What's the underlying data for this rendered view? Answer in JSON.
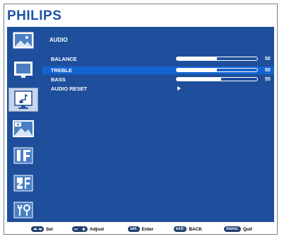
{
  "brand": "PHILIPS",
  "menu": {
    "title": "AUDIO",
    "items": [
      {
        "label": "BALANCE",
        "value": "50",
        "level": 0.5,
        "selected": false
      },
      {
        "label": "TREBLE",
        "value": "50",
        "level": 0.5,
        "selected": true
      },
      {
        "label": "BASS",
        "value": "55",
        "level": 0.55,
        "selected": false
      },
      {
        "label": "AUDIO RESET",
        "action": "arrow-right-icon",
        "selected": false
      }
    ]
  },
  "sidebar": {
    "items": [
      {
        "icon": "picture-icon"
      },
      {
        "icon": "screen-icon"
      },
      {
        "icon": "audio-icon",
        "selected": true
      },
      {
        "icon": "pip-icon"
      },
      {
        "icon": "configuration1-icon"
      },
      {
        "icon": "configuration2-icon"
      },
      {
        "icon": "tools-icon"
      }
    ]
  },
  "footer": {
    "sel_key": "up-down-icon",
    "sel": "Sel",
    "adjust_key": "plus-minus-icon",
    "adjust": "Adjust",
    "enter_key": "set:",
    "enter": "Enter",
    "back_key": "exit:",
    "back": "BACK",
    "quit_key": "menu:",
    "quit": "Quit"
  },
  "colors": {
    "brand": "#1d52a8",
    "panel": "#1f4f9c",
    "highlight": "#1364d0",
    "key_bg": "#1f3f6f"
  }
}
